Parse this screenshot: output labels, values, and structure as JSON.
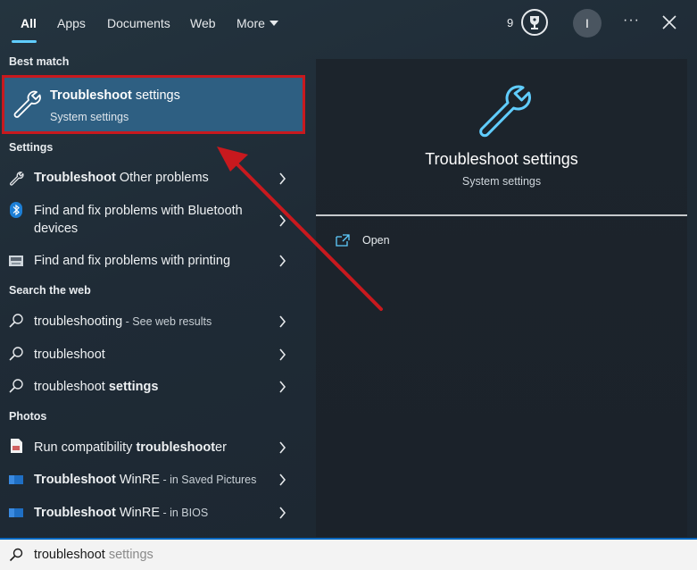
{
  "tabs": {
    "all": "All",
    "apps": "Apps",
    "documents": "Documents",
    "web": "Web",
    "more": "More"
  },
  "header": {
    "points": "9",
    "avatar_initial": "I",
    "more_options": "···"
  },
  "sections": {
    "best_match": "Best match",
    "settings": "Settings",
    "search_web": "Search the web",
    "photos": "Photos"
  },
  "best_match": {
    "title_bold": "Troubleshoot",
    "title_rest": " settings",
    "subtitle": "System settings",
    "icon": "wrench-icon"
  },
  "settings_items": [
    {
      "bold": "Troubleshoot",
      "rest": " Other problems",
      "icon": "wrench-icon"
    },
    {
      "line1": "Find and fix problems with Bluetooth",
      "line2": "devices",
      "icon": "bluetooth-icon"
    },
    {
      "text": "Find and fix problems with printing",
      "icon": "printer-icon"
    }
  ],
  "web_items": [
    {
      "main": "troubleshooting",
      "suffix": " - See web results",
      "icon": "search-icon"
    },
    {
      "main": "troubleshoot",
      "icon": "search-icon"
    },
    {
      "main": "troubleshoot ",
      "bold": "settings",
      "icon": "search-icon"
    }
  ],
  "photo_items": [
    {
      "pre": "Run compatibility ",
      "bold": "troubleshoot",
      "post": "er",
      "icon": "document-image-icon"
    },
    {
      "bold": "Troubleshoot",
      "rest": " WinRE",
      "suffix": " - in Saved Pictures",
      "icon": "image-thumbnail-icon"
    },
    {
      "bold": "Troubleshoot",
      "rest": " WinRE",
      "suffix": " - in BIOS",
      "icon": "image-thumbnail-icon"
    }
  ],
  "preview": {
    "title": "Troubleshoot settings",
    "subtitle": "System settings",
    "open_label": "Open",
    "icon": "wrench-icon"
  },
  "search": {
    "typed": "troubleshoot",
    "completion": " settings"
  },
  "colors": {
    "accent": "#60cdff",
    "highlight_bg": "#2e5f82",
    "annotation_red": "#c8191e",
    "search_border": "#0067c0"
  }
}
